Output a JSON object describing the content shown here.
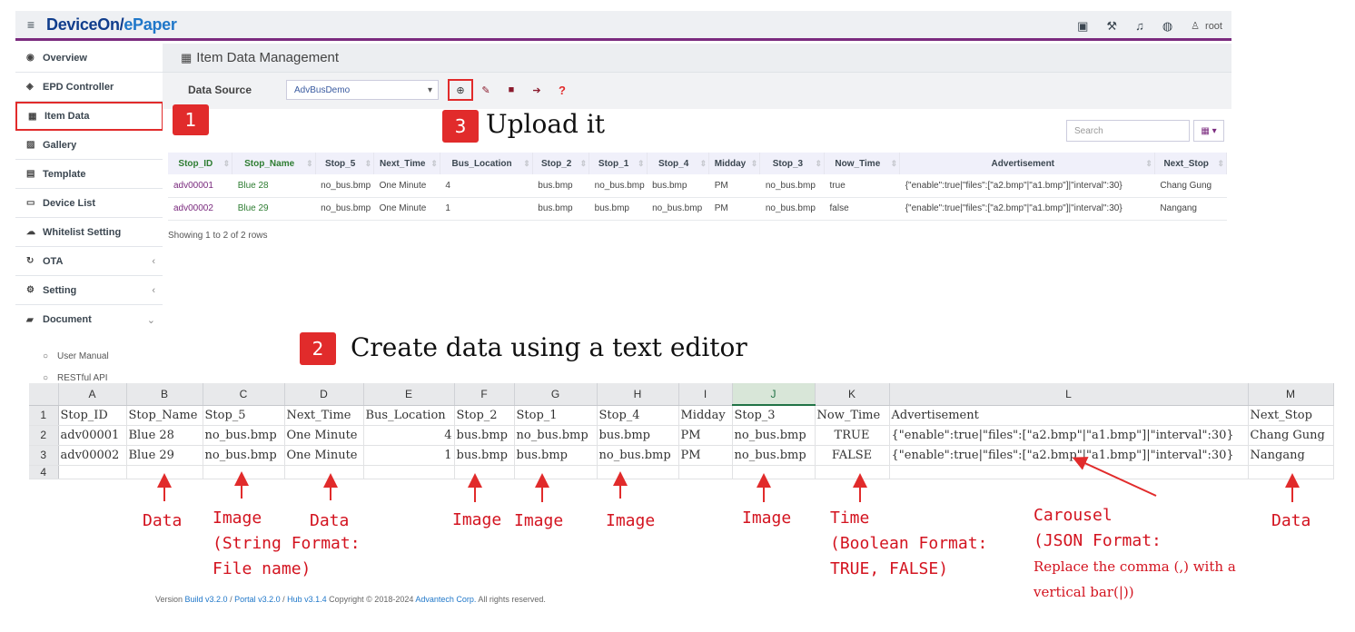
{
  "app": {
    "brand_a": "DeviceOn/",
    "brand_b": "ePaper",
    "user": "root"
  },
  "sidebar": {
    "items": [
      {
        "label": "Overview"
      },
      {
        "label": "EPD Controller"
      },
      {
        "label": "Item Data"
      },
      {
        "label": "Gallery"
      },
      {
        "label": "Template"
      },
      {
        "label": "Device List"
      },
      {
        "label": "Whitelist Setting"
      },
      {
        "label": "OTA"
      },
      {
        "label": "Setting"
      },
      {
        "label": "Document"
      }
    ],
    "sub_items": [
      {
        "label": "User Manual"
      },
      {
        "label": "RESTful API"
      }
    ]
  },
  "page": {
    "title": "Item Data Management",
    "data_source_label": "Data Source",
    "data_source_value": "AdvBusDemo",
    "search_placeholder": "Search",
    "showing": "Showing 1 to 2 of 2 rows"
  },
  "table": {
    "headers": [
      "Stop_ID",
      "Stop_Name",
      "Stop_5",
      "Next_Time",
      "Bus_Location",
      "Stop_2",
      "Stop_1",
      "Stop_4",
      "Midday",
      "Stop_3",
      "Now_Time",
      "Advertisement",
      "Next_Stop"
    ],
    "rows": [
      [
        "adv00001",
        "Blue 28",
        "no_bus.bmp",
        "One Minute",
        "4",
        "bus.bmp",
        "no_bus.bmp",
        "bus.bmp",
        "PM",
        "no_bus.bmp",
        "true",
        "{\"enable\":true|\"files\":[\"a2.bmp\"|\"a1.bmp\"]|\"interval\":30}",
        "Chang Gung"
      ],
      [
        "adv00002",
        "Blue 29",
        "no_bus.bmp",
        "One Minute",
        "1",
        "bus.bmp",
        "bus.bmp",
        "no_bus.bmp",
        "PM",
        "no_bus.bmp",
        "false",
        "{\"enable\":true|\"files\":[\"a2.bmp\"|\"a1.bmp\"]|\"interval\":30}",
        "Nangang"
      ]
    ]
  },
  "footer": {
    "prefix": "Version ",
    "build": "Build v3.2.0",
    "sep1": " / ",
    "portal": "Portal v3.2.0",
    "sep2": " / ",
    "hub": "Hub v3.1.4",
    "copy": " Copyright © 2018-2024 ",
    "corp": "Advantech Corp.",
    "rights": " All rights reserved."
  },
  "spreadsheet": {
    "columns": [
      "A",
      "B",
      "C",
      "D",
      "E",
      "F",
      "G",
      "H",
      "I",
      "J",
      "K",
      "L",
      "M"
    ],
    "row_numbers": [
      "1",
      "2",
      "3",
      "4"
    ],
    "rows": [
      [
        "Stop_ID",
        "Stop_Name",
        "Stop_5",
        "Next_Time",
        "Bus_Location",
        "Stop_2",
        "Stop_1",
        "Stop_4",
        "Midday",
        "Stop_3",
        "Now_Time",
        "Advertisement",
        "Next_Stop"
      ],
      [
        "adv00001",
        "Blue 28",
        "no_bus.bmp",
        "One Minute",
        "4",
        "bus.bmp",
        "no_bus.bmp",
        "bus.bmp",
        "PM",
        "no_bus.bmp",
        "TRUE",
        "{\"enable\":true|\"files\":[\"a2.bmp\"|\"a1.bmp\"]|\"interval\":30}",
        "Chang Gung"
      ],
      [
        "adv00002",
        "Blue 29",
        "no_bus.bmp",
        "One Minute",
        "1",
        "bus.bmp",
        "bus.bmp",
        "no_bus.bmp",
        "PM",
        "no_bus.bmp",
        "FALSE",
        "{\"enable\":true|\"files\":[\"a2.bmp\"|\"a1.bmp\"]|\"interval\":30}",
        "Nangang"
      ]
    ]
  },
  "annotations": {
    "step1": "1",
    "step2": "2",
    "step2_text": "Create data using a text editor",
    "step3": "3",
    "step3_text": "Upload it",
    "labels": {
      "data_b": "Data",
      "image_c": "Image\n(String Format:\nFile name)",
      "data_d": "Data",
      "image_f": "Image",
      "image_g": "Image",
      "image_h": "Image",
      "image_j": "Image",
      "time_k": "Time\n(Boolean Format:\nTRUE, FALSE)",
      "carousel": "Carousel\n(JSON Format:",
      "carousel_note": "Replace the comma (,) with a\nvertical bar(|))",
      "data_m": "Data"
    },
    "accent": "#e12b2b"
  }
}
